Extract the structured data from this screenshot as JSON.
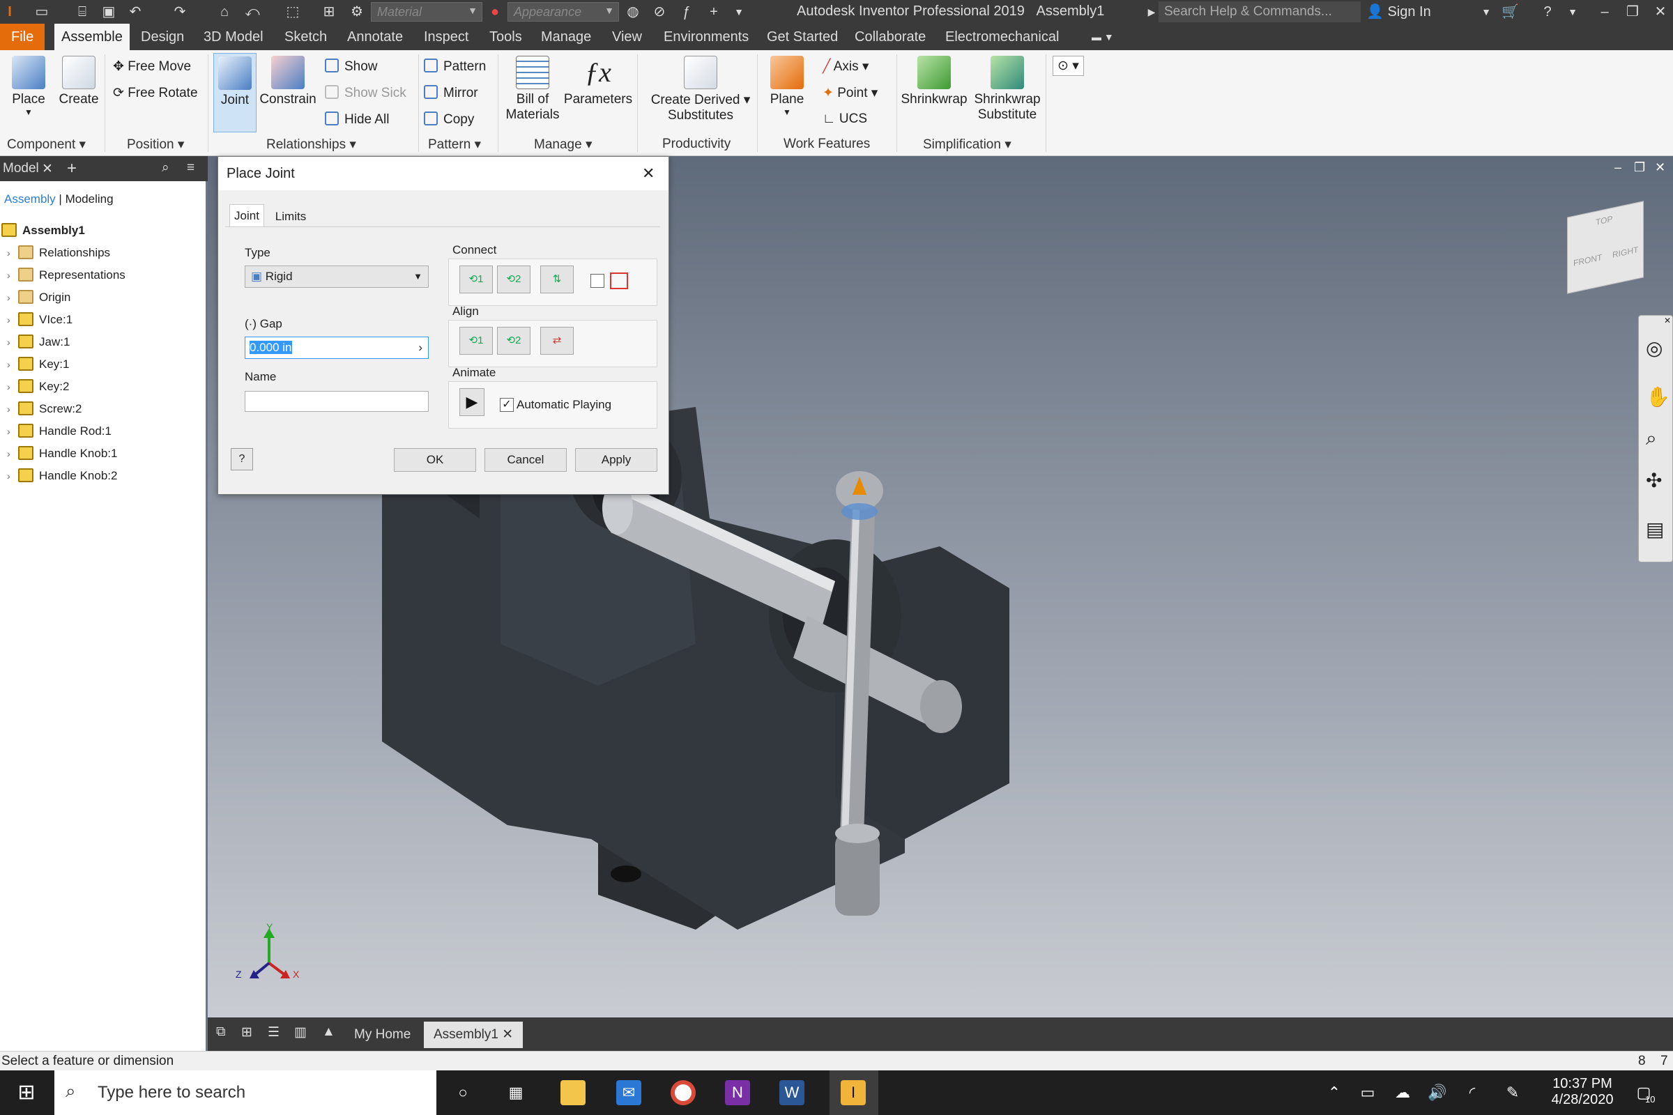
{
  "titlebar": {
    "material_placeholder": "Material",
    "appearance_placeholder": "Appearance",
    "app_title": "Autodesk Inventor Professional 2019",
    "document": "Assembly1",
    "search_placeholder": "Search Help & Commands...",
    "sign_in": "Sign In"
  },
  "ribbon_tabs": [
    "File",
    "Assemble",
    "Design",
    "3D Model",
    "Sketch",
    "Annotate",
    "Inspect",
    "Tools",
    "Manage",
    "View",
    "Environments",
    "Get Started",
    "Collaborate",
    "Electromechanical"
  ],
  "ribbon": {
    "place": "Place",
    "create": "Create",
    "component_label": "Component",
    "free_move": "Free Move",
    "free_rotate": "Free Rotate",
    "position_label": "Position",
    "joint": "Joint",
    "constrain": "Constrain",
    "show": "Show",
    "show_sick": "Show Sick",
    "hide_all": "Hide All",
    "relationships_label": "Relationships",
    "pattern": "Pattern",
    "mirror": "Mirror",
    "copy": "Copy",
    "pattern_label": "Pattern",
    "bom_1": "Bill of",
    "bom_2": "Materials",
    "parameters": "Parameters",
    "manage_label": "Manage",
    "cds_1": "Create Derived",
    "cds_2": "Substitutes",
    "productivity_label": "Productivity",
    "plane": "Plane",
    "axis": "Axis",
    "point": "Point",
    "ucs": "UCS",
    "work_features_label": "Work Features",
    "shrinkwrap": "Shrinkwrap",
    "shrinkwrap_sub_1": "Shrinkwrap",
    "shrinkwrap_sub_2": "Substitute",
    "simplification_label": "Simplification"
  },
  "browser": {
    "tab": "Model",
    "view_assembly": "Assembly",
    "view_modeling": "Modeling",
    "root": "Assembly1",
    "items": [
      "Relationships",
      "Representations",
      "Origin",
      "VIce:1",
      "Jaw:1",
      "Key:1",
      "Key:2",
      "Screw:2",
      "Handle Rod:1",
      "Handle Knob:1",
      "Handle Knob:2"
    ]
  },
  "dialog": {
    "title": "Place Joint",
    "tab_joint": "Joint",
    "tab_limits": "Limits",
    "type_label": "Type",
    "type_value": "Rigid",
    "gap_label": "Gap",
    "gap_value": "0.000 in",
    "name_label": "Name",
    "name_value": "",
    "connect_label": "Connect",
    "align_label": "Align",
    "animate_label": "Animate",
    "auto_play": "Automatic Playing",
    "ok": "OK",
    "cancel": "Cancel",
    "apply": "Apply",
    "btn_1": "1",
    "btn_2": "2"
  },
  "viewcube": {
    "top": "TOP",
    "front": "FRONT",
    "right": "RIGHT"
  },
  "triad": {
    "x": "X",
    "y": "Y",
    "z": "Z"
  },
  "doc_tabs": {
    "home": "My Home",
    "doc": "Assembly1"
  },
  "status": {
    "message": "Select a feature or dimension",
    "num1": "8",
    "num2": "7"
  },
  "taskbar": {
    "search_placeholder": "Type here to search",
    "time": "10:37 PM",
    "date": "4/28/2020",
    "notif_count": "10"
  },
  "colors": {
    "file_tab": "#e46c0a",
    "dark_chrome": "#3a3a3a",
    "selection": "#3399ff"
  }
}
